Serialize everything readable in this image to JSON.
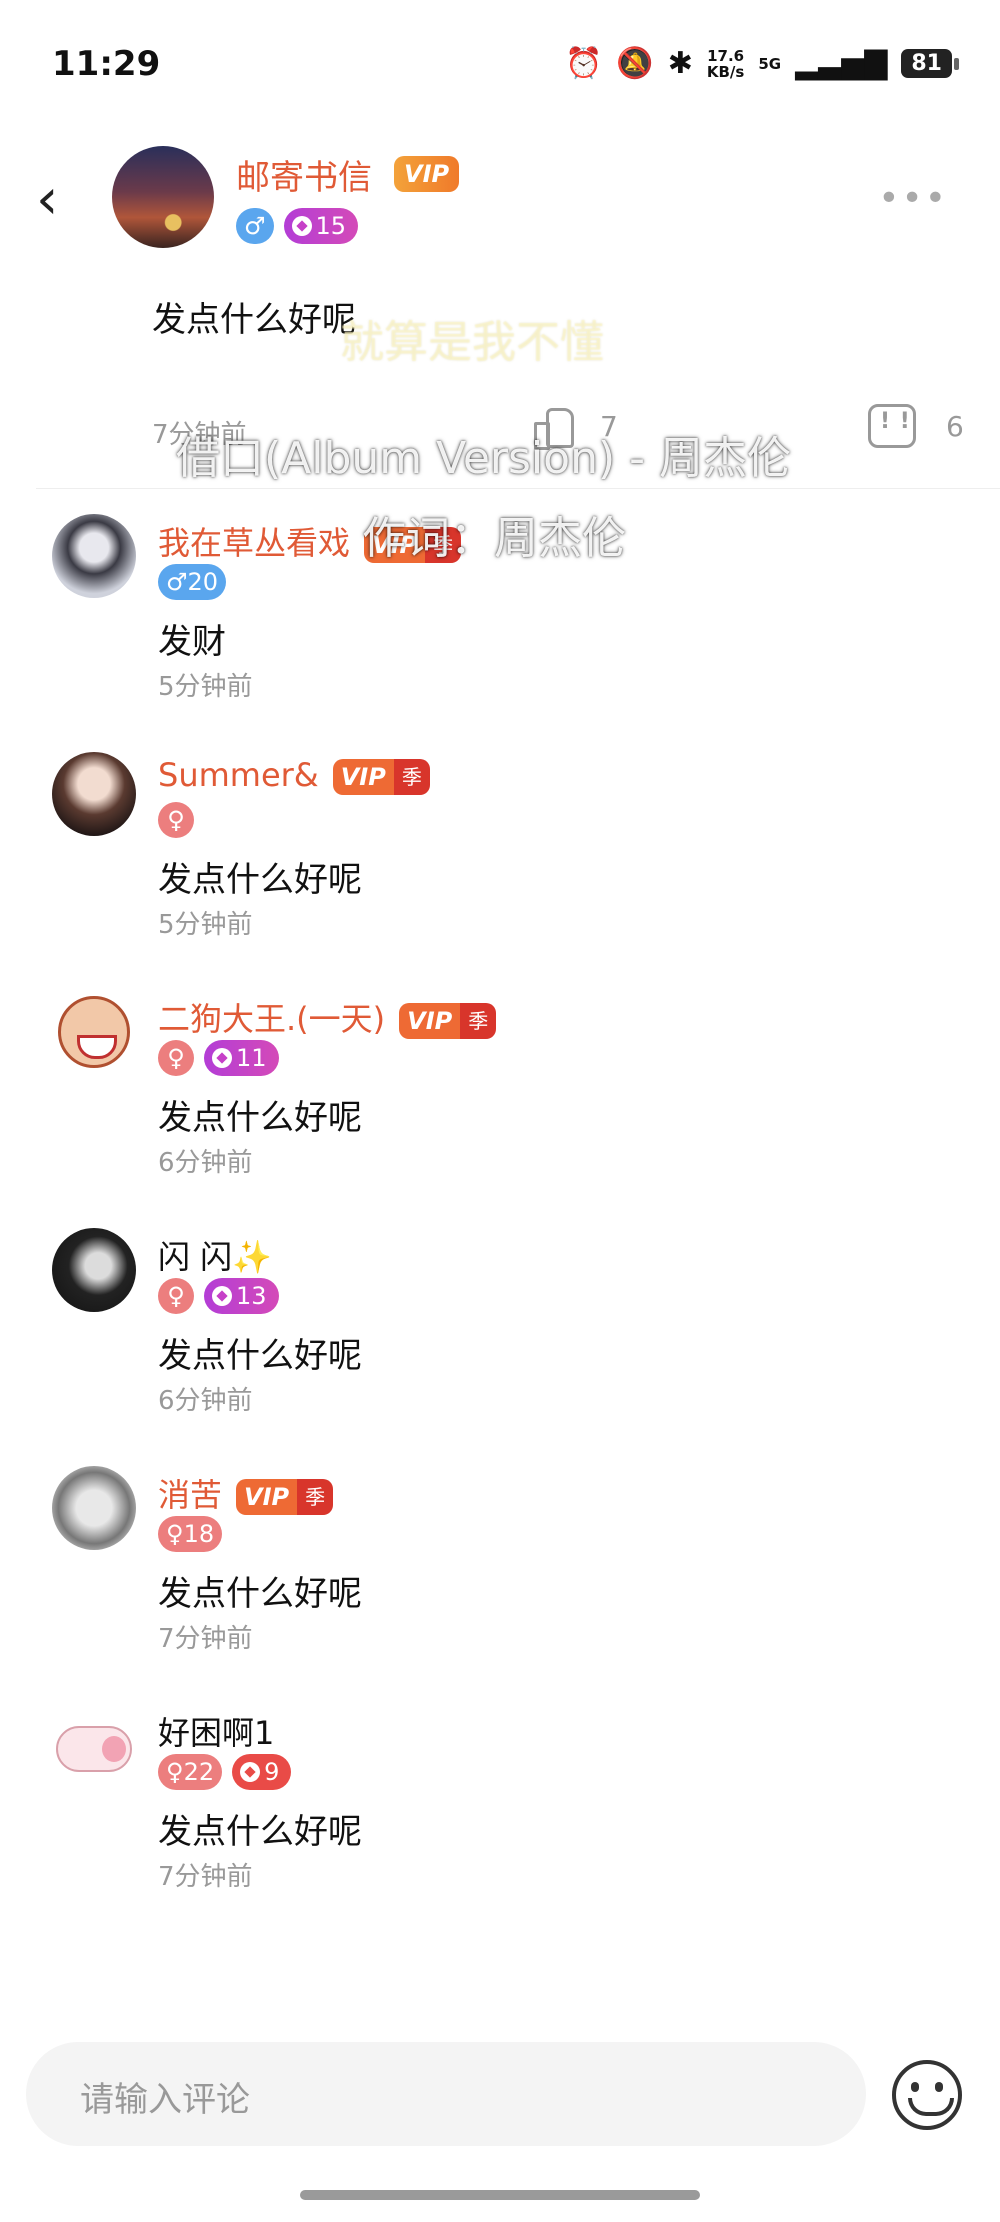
{
  "status_bar": {
    "time": "11:29",
    "speed_value": "17.6",
    "speed_unit": "KB/s",
    "network": "5G",
    "battery": "81"
  },
  "post": {
    "author": "邮寄书信",
    "vip_label": "VIP",
    "level": "15",
    "text": "发点什么好呢",
    "time": "7分钟前",
    "like_count": "7",
    "comment_count": "6"
  },
  "lyrics": {
    "line1": "就算是我不懂",
    "line2": "借口(Album Version) - 周杰伦",
    "line3": "作词：周杰伦"
  },
  "comments": [
    {
      "name": "我在草丛看戏",
      "level": "20",
      "text": "发财",
      "time": "5分钟前"
    },
    {
      "name": "Summer&",
      "text": "发点什么好呢",
      "time": "5分钟前"
    },
    {
      "name": "二狗大王.(一天)",
      "level": "11",
      "text": "发点什么好呢",
      "time": "6分钟前"
    },
    {
      "name": "闪 闪✨",
      "level": "13",
      "text": "发点什么好呢",
      "time": "6分钟前"
    },
    {
      "name": "消苦",
      "level": "18",
      "text": "发点什么好呢",
      "time": "7分钟前"
    },
    {
      "name": "好困啊1",
      "level": "22",
      "level2": "9",
      "text": "发点什么好呢",
      "time": "7分钟前"
    }
  ],
  "vip_badge": {
    "vip": "VIP",
    "season": "季"
  },
  "input": {
    "placeholder": "请输入评论"
  },
  "icons": {
    "back": "back-arrow-icon",
    "more": "more-dots-icon",
    "like": "thumb-up-icon",
    "comment": "comment-bubble-icon",
    "emoji": "emoji-icon"
  },
  "colors": {
    "accent_name": "#e05a36",
    "male": "#5aa6ee",
    "female": "#ec7e7e",
    "vip": "#f07a2a"
  }
}
